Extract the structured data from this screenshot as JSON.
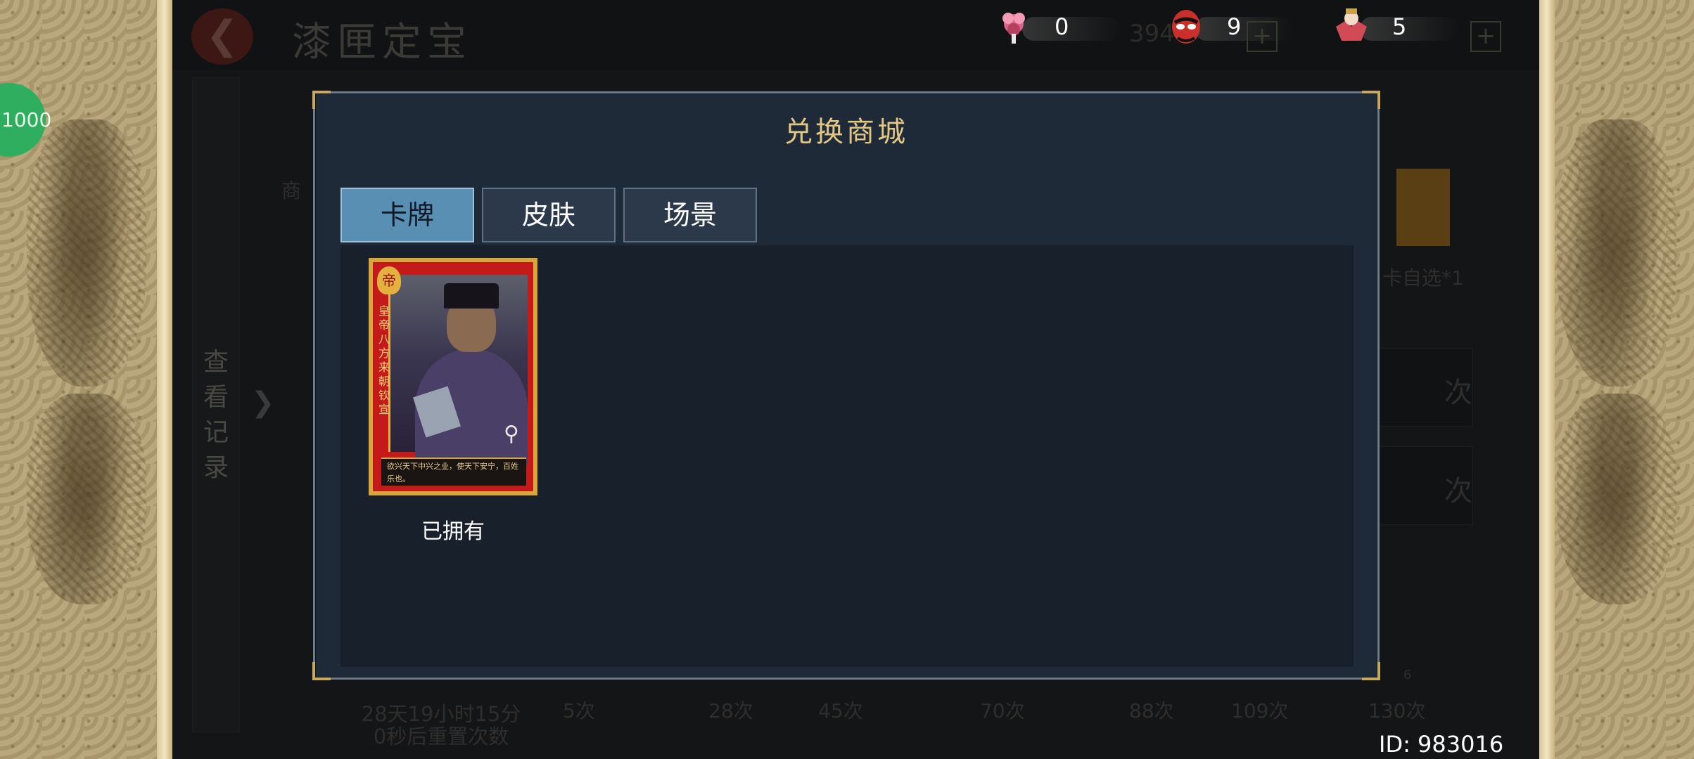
{
  "background": {
    "title": "漆匣定宝",
    "back_icon": "back-arrow-icon",
    "resources": [
      {
        "icon": "flower-token-icon",
        "value": "0"
      },
      {
        "icon": "red-mask-icon",
        "value": "9"
      },
      {
        "icon": "opera-figure-icon",
        "value": "5"
      }
    ],
    "dim_count": "394",
    "view_records": "查看记录",
    "shop_label": "商",
    "item_label": "卡自选*1",
    "counts": [
      "5次",
      "28次",
      "45次",
      "70次",
      "88次",
      "109次",
      "130次"
    ],
    "reset_text": "28天19小时15分0秒后重置次数",
    "side_badge": "1000",
    "side_btn_text": "次",
    "corner_badge_count": "6"
  },
  "id_label": "ID: 983016",
  "modal": {
    "title": "兑换商城",
    "tabs": [
      {
        "label": "卡牌",
        "active": true
      },
      {
        "label": "皮肤",
        "active": false
      },
      {
        "label": "场景",
        "active": false
      }
    ],
    "items": [
      {
        "emblem": "帝",
        "side_text": "皇帝八方来朝",
        "name": "钦宣",
        "desc": "欲兴天下中兴之业，使天下安宁，百姓乐也。",
        "status": "已拥有",
        "zoom_icon": "magnifier-icon"
      }
    ]
  }
}
